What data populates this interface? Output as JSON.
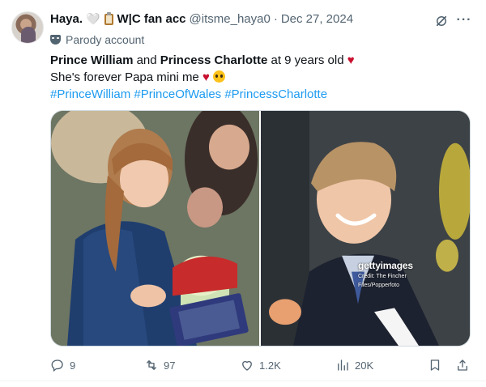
{
  "tweet": {
    "display_name": "Haya.",
    "name_heart": "🤍",
    "name_suffix": "W|C fan acc",
    "handle": "@itsme_haya0",
    "separator": "·",
    "date": "Dec 27, 2024",
    "parody_label": "Parody account",
    "text": {
      "bold1": "Prince William",
      "and": " and ",
      "bold2": "Princess Charlotte",
      "rest": " at 9 years old ",
      "heart": "♥",
      "line2": "She's forever Papa mini me ",
      "heart2": "♥",
      "hashtags": "#PrinceWilliam #PrinceOfWales #PrincessCharlotte"
    },
    "media": {
      "watermark": "gettyimages",
      "credit_line1": "Credit: The Fincher",
      "credit_line2": "Files/Popperfoto"
    },
    "actions": {
      "replies": "9",
      "retweets": "97",
      "likes": "1.2K",
      "views": "20K"
    }
  },
  "icons": [
    "avatar",
    "clipboard-icon",
    "grok-icon",
    "more-icon",
    "parody-mask-icon",
    "reply-icon",
    "retweet-icon",
    "like-icon",
    "views-icon",
    "bookmark-icon",
    "share-icon"
  ],
  "colors": {
    "link": "#1d9bf0",
    "secondary_text": "#536471",
    "heart_red": "#c8102e"
  }
}
